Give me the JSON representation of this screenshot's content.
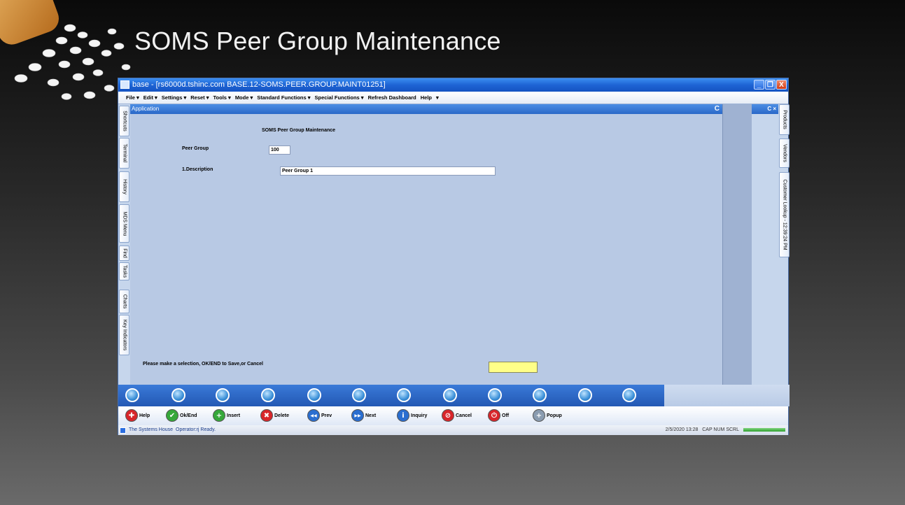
{
  "slide": {
    "title": "SOMS Peer Group Maintenance"
  },
  "window": {
    "title": "base - [rs6000d.tshinc.com BASE.12-SOMS.PEER.GROUP.MAINT01251]",
    "controls": {
      "minimize": "_",
      "restore": "❐",
      "close": "X"
    }
  },
  "menu": {
    "items": [
      "File ▾",
      "Edit ▾",
      "Settings ▾",
      "Reset ▾",
      "Tools ▾",
      "Mode ▾",
      "Standard Functions ▾",
      "Special Functions ▾",
      "Refresh Dashboard",
      "Help",
      "▾"
    ]
  },
  "left_tabs": [
    "Shortcuts",
    "Terminal",
    "History",
    "MDS Menu",
    "Find",
    "Tasks",
    "Charts",
    "Key Indicators"
  ],
  "right_tabs": [
    "Products",
    "Vendors",
    "Customer Lookup - 12:39:24 PM"
  ],
  "panel": {
    "header": "Application",
    "refresh_glyph": "C",
    "right_header": "C ×"
  },
  "form": {
    "title": "SOMS Peer Group Maintenance",
    "peer_group_label": "Peer Group",
    "peer_group_value": "100",
    "description_label": "1.Description",
    "description_value": "Peer Group 1",
    "prompt": "Please make a selection, OK/END to Save,or Cancel",
    "input_value": ""
  },
  "toolbar": {
    "buttons": [
      {
        "label": "Help",
        "icon": "lifebuoy-icon",
        "color": "#d8262a",
        "glyph": "✚"
      },
      {
        "label": "Ok/End",
        "icon": "check-icon",
        "color": "#36a83a",
        "glyph": "✔"
      },
      {
        "label": "Insert",
        "icon": "plus-icon",
        "color": "#36a83a",
        "glyph": "+"
      },
      {
        "label": "Delete",
        "icon": "x-icon",
        "color": "#d8262a",
        "glyph": "✖"
      },
      {
        "label": "Prev",
        "icon": "rewind-icon",
        "color": "#2a6ed0",
        "glyph": "◀◀"
      },
      {
        "label": "Next",
        "icon": "fast-forward-icon",
        "color": "#2a6ed0",
        "glyph": "▶▶"
      },
      {
        "label": "Inquiry",
        "icon": "info-icon",
        "color": "#2a6ed0",
        "glyph": "i"
      },
      {
        "label": "Cancel",
        "icon": "cancel-icon",
        "color": "#d8262a",
        "glyph": "⊘"
      },
      {
        "label": "Off",
        "icon": "power-icon",
        "color": "#d8262a",
        "glyph": "⏻"
      },
      {
        "label": "Popup",
        "icon": "database-add-icon",
        "color": "#8a9cb0",
        "glyph": "+"
      }
    ]
  },
  "status": {
    "company": "The Systems House",
    "operator": "Operator:rj Ready.",
    "datetime": "2/5/2020 13:28",
    "indicators": "CAP  NUM  SCRL"
  }
}
